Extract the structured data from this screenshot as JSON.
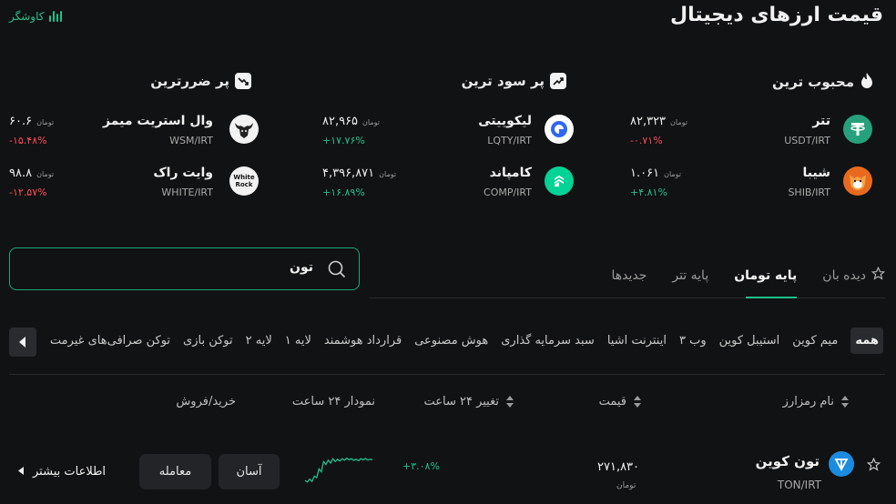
{
  "page_title": "قیمت ارزهای دیجیتال",
  "explorer_label": "کاوشگر",
  "sections": [
    {
      "title": "محبوب ترین",
      "icon": "flame-icon",
      "coins": [
        {
          "name": "تتر",
          "pair": "USDT/IRT",
          "price": "۸۲,۳۲۳",
          "unit": "تومان",
          "change": "-۰.۷۱%",
          "trend": "neg",
          "logo": "usdt-logo"
        },
        {
          "name": "شیبا",
          "pair": "SHIB/IRT",
          "price": "۱.۰۶۱",
          "unit": "تومان",
          "change": "+۴.۸۱%",
          "trend": "pos",
          "logo": "shib-logo"
        }
      ]
    },
    {
      "title": "پر سود ترین",
      "icon": "trend-up-icon",
      "coins": [
        {
          "name": "لیکوییتی",
          "pair": "LQTY/IRT",
          "price": "۸۲,۹۶۵",
          "unit": "تومان",
          "change": "+۱۷.۷۶%",
          "trend": "pos",
          "logo": "lqty-logo"
        },
        {
          "name": "کامپاند",
          "pair": "COMP/IRT",
          "price": "۴,۳۹۶,۸۷۱",
          "unit": "تومان",
          "change": "+۱۶.۸۹%",
          "trend": "pos",
          "logo": "comp-logo"
        }
      ]
    },
    {
      "title": "پر ضررترین",
      "icon": "trend-down-icon",
      "coins": [
        {
          "name": "وال استریت میمز",
          "pair": "WSM/IRT",
          "price": "۶۰.۶",
          "unit": "تومان",
          "change": "-۱۵.۴۸%",
          "trend": "neg",
          "logo": "wsm-logo"
        },
        {
          "name": "وایت راک",
          "pair": "WHITE/IRT",
          "price": "۹۸.۸",
          "unit": "تومان",
          "change": "-۱۲.۵۷%",
          "trend": "neg",
          "logo": "white-logo",
          "logo_text": "White Rock"
        }
      ]
    }
  ],
  "search": {
    "value": "تون"
  },
  "tabs": [
    {
      "label": "دیده بان",
      "icon": "star-icon"
    },
    {
      "label": "پایه تومان",
      "active": true
    },
    {
      "label": "پایه تتر"
    },
    {
      "label": "جدیدها"
    }
  ],
  "categories": [
    "همه",
    "میم کوین",
    "استیبل کوین",
    "وب ۳",
    "اینترنت اشیا",
    "سبد سرمایه گذاری",
    "هوش مصنوعی",
    "قرارداد هوشمند",
    "لایه ۱",
    "لایه ۲",
    "توکن بازی",
    "توکن صرافی‌های غیرمت"
  ],
  "table_headers": {
    "symbol": "نام رمزارز",
    "price": "قیمت",
    "change": "تغییر ۲۴ ساعت",
    "chart": "نمودار ۲۴ ساعت",
    "trade": "خرید/فروش"
  },
  "row": {
    "name": "تون کوین",
    "pair": "TON/IRT",
    "price": "۲۷۱,۸۳۰",
    "unit": "تومان",
    "change": "+۳.۰۸%",
    "buttons": {
      "easy": "آسان",
      "trade": "معامله"
    },
    "more": "اطلاعات بیشتر",
    "sparkline": [
      0.15,
      0.1,
      0.2,
      0.12,
      0.3,
      0.25,
      0.55,
      0.45,
      0.8,
      0.7,
      0.85,
      0.75,
      0.9,
      0.8,
      0.88,
      0.82,
      0.9,
      0.85,
      0.92,
      0.86,
      0.9,
      0.84,
      0.88,
      0.83,
      0.9,
      0.86,
      0.91,
      0.85,
      0.88,
      0.87
    ]
  },
  "colors": {
    "accent": "#1fc08a",
    "negative": "#ff4a5a",
    "background": "#111213"
  }
}
